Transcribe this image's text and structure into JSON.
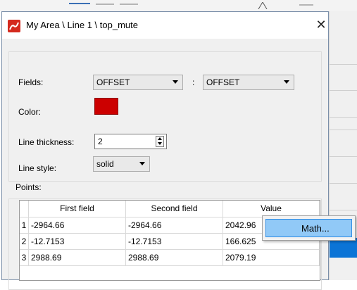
{
  "window": {
    "title": "My Area \\ Line 1 \\ top_mute",
    "close_glyph": "✕"
  },
  "fields": {
    "label": "Fields:",
    "first_value": "OFFSET",
    "separator": ":",
    "second_value": "OFFSET"
  },
  "color": {
    "label": "Color:",
    "value": "#cc0000"
  },
  "line_thickness": {
    "label": "Line thickness:",
    "value": "2"
  },
  "line_style": {
    "label": "Line style:",
    "value": "solid"
  },
  "points": {
    "label": "Points:",
    "columns": [
      "First field",
      "Second field",
      "Value"
    ],
    "rows": [
      {
        "index": "1",
        "first": "-2964.66",
        "second": "-2964.66",
        "value": "2042.96"
      },
      {
        "index": "2",
        "first": "-12.7153",
        "second": "-12.7153",
        "value": "166.625"
      },
      {
        "index": "3",
        "first": "2988.69",
        "second": "2988.69",
        "value": "2079.19"
      }
    ]
  },
  "context_menu": {
    "items": [
      {
        "label": "Math..."
      }
    ]
  },
  "colors": {
    "accent": "#0b74d6",
    "selection": "#91c9f7",
    "swatch": "#cc0000"
  }
}
